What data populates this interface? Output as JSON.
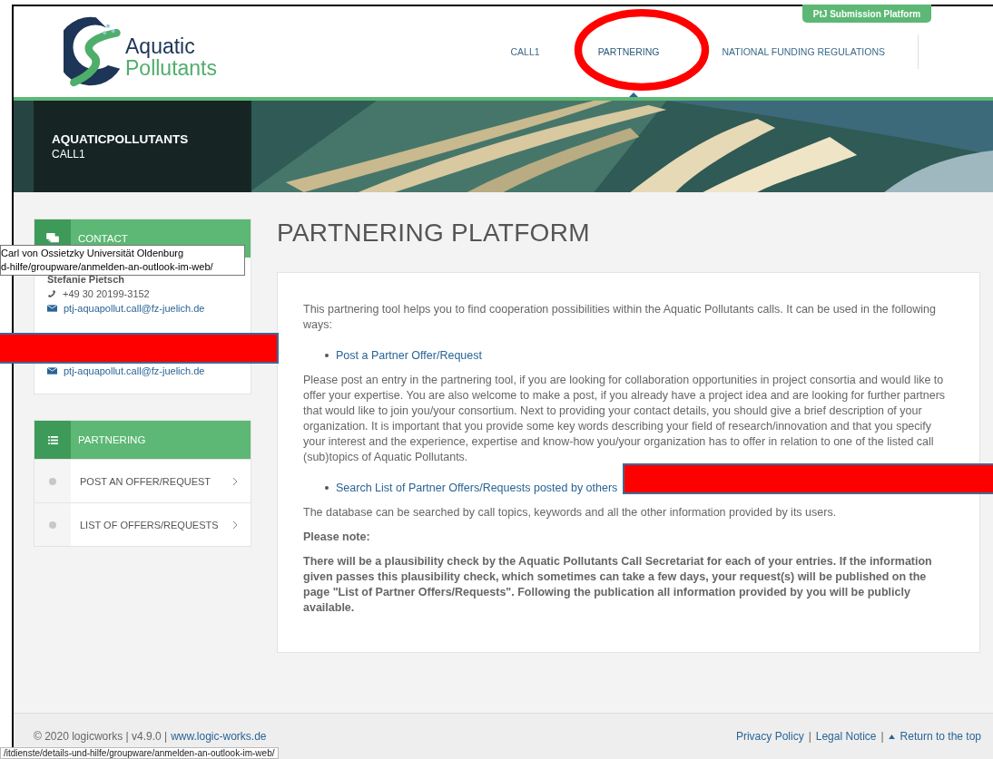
{
  "header": {
    "submission_button": "PtJ Submission Platform",
    "logo": {
      "line1": "Aquatic",
      "line2": "Pollutants"
    },
    "nav": [
      {
        "label": "CALL1",
        "selected": false
      },
      {
        "label": "PARTNERING",
        "selected": true
      },
      {
        "label": "NATIONAL FUNDING REGULATIONS",
        "selected": false
      }
    ]
  },
  "banner": {
    "title": "AQUATICPOLLUTANTS",
    "subtitle": "CALL1"
  },
  "contact": {
    "heading": "CONTACT",
    "name": "Stefanie Pietsch",
    "phone": "+49 30 20199-3152",
    "emails": [
      "ptj-aquapollut.call@fz-juelich.de",
      "ptj-aquapollut.call@fz-juelich.de"
    ]
  },
  "partnering_menu": {
    "heading": "PARTNERING",
    "items": [
      {
        "label": "POST AN OFFER/REQUEST",
        "selected": false
      },
      {
        "label": "LIST OF OFFERS/REQUESTS",
        "selected": false
      }
    ]
  },
  "page_title": "PARTNERING PLATFORM",
  "content": [
    {
      "kind": "paragraph",
      "text": "This partnering tool helps you to find cooperation possibilities within the Aquatic Pollutants calls. It can be used in the following ways:"
    },
    {
      "kind": "link",
      "text": "Post a Partner Offer/Request"
    },
    {
      "kind": "paragraph",
      "text": "Please post an entry in the partnering tool, if you are looking for collaboration opportunities in project consortia and would like to offer your expertise. You are also welcome to make a post, if you already have a project idea and are looking for further partners that would like to join you/your consortium. Next to providing your contact details, you should give a brief description of your organization. It is important that you provide some key words describing your field of research/innovation and that you specify your interest and the experience, expertise and know-how you/your organization has to offer in relation to one of the listed call (sub)topics of Aquatic Pollutants."
    },
    {
      "kind": "link",
      "text": "Search List of Partner Offers/Requests posted by others"
    },
    {
      "kind": "paragraph",
      "text": "The database can be searched by call topics, keywords and all the other information provided by its users."
    },
    {
      "kind": "note",
      "text": "Please note:"
    },
    {
      "kind": "note",
      "text": "There will be a plausibility check by the Aquatic Pollutants Call Secretariat for each of your entries. If the information given passes this plausibility check, which sometimes can take a few days, your request(s) will be published on the page \"List of Partner Offers/Requests\". Following the publication all information provided by you will be publicly available."
    }
  ],
  "footer": {
    "copyright": "© 2020 logicworks | v4.9.0 |",
    "site_link": "www.logic-works.de",
    "links": [
      {
        "kind": "link",
        "text": "Privacy Policy"
      },
      {
        "kind": "sep",
        "text": "|"
      },
      {
        "kind": "link",
        "text": "Legal Notice"
      },
      {
        "kind": "sep",
        "text": "|"
      },
      {
        "kind": "top",
        "text": "Return to the top"
      }
    ]
  },
  "tooltip": {
    "lines": [
      "Carl von Ossietzky Universität Oldenburg",
      "d-hilfe/groupware/anmelden-an-outlook-im-web/"
    ]
  },
  "status_url": "/itdienste/details-und-hilfe/groupware/anmelden-an-outlook-im-web/",
  "markup": [
    {
      "kind": "circle"
    },
    {
      "kind": "bar"
    },
    {
      "kind": "bar"
    }
  ]
}
